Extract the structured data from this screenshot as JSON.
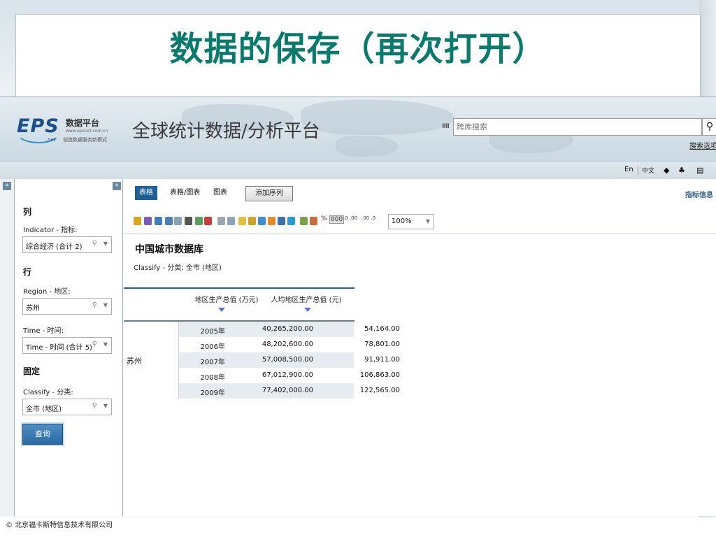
{
  "slide": {
    "title": "数据的保存（再次打开）",
    "copyright": "© 北京福卡斯特信息技术有限公司"
  },
  "header": {
    "logo_text": "EPS",
    "logo_net": "net",
    "logo_cn": "数据平台",
    "logo_url": "www.epsnet.com.cn",
    "logo_slogan": "创造数据服务新模式",
    "platform_title": "全球统计数据/分析平台",
    "search_placeholder": "跨库搜索",
    "search_options": "搜索选项"
  },
  "topbar": {
    "lang_en": "En",
    "lang_cn": "中文",
    "icons": [
      "back-icon",
      "users-icon",
      "document-icon"
    ]
  },
  "left_panel": {
    "column_section": "列",
    "indicator_label": "Indicator - 指标:",
    "indicator_value": "综合经济 (合计 2)",
    "row_section": "行",
    "region_label": "Region - 地区:",
    "region_value": "苏州",
    "time_label": "Time - 时间:",
    "time_value": "Time - 时间 (合计 5)",
    "fixed_section": "固定",
    "classify_label": "Classify - 分类:",
    "classify_value": "全市 (地区)",
    "query_button": "查询"
  },
  "main": {
    "tabs": [
      "表格",
      "表格/图表",
      "图表"
    ],
    "active_tab": "表格",
    "add_series": "添加序列",
    "indicator_info": "指标信息",
    "zoom": "100%",
    "toolbar_labels": {
      "percent": "%",
      "thousands": "000",
      "inc_dec_1": ".0 .00",
      "inc_dec_2": ".00 .0"
    },
    "db_title": "中国城市数据库",
    "db_subtitle": "Classify - 分类: 全市 (地区)"
  },
  "table": {
    "columns": [
      "地区生产总值 (万元)",
      "人均地区生产总值 (元)"
    ],
    "region": "苏州",
    "rows": [
      {
        "year": "2005年",
        "gdp": "40,265,200.00",
        "per_capita": "54,164.00"
      },
      {
        "year": "2006年",
        "gdp": "48,202,600.00",
        "per_capita": "78,801.00"
      },
      {
        "year": "2007年",
        "gdp": "57,008,500.00",
        "per_capita": "91,911.00"
      },
      {
        "year": "2008年",
        "gdp": "67,012,900.00",
        "per_capita": "106,863.00"
      },
      {
        "year": "2009年",
        "gdp": "77,402,000.00",
        "per_capita": "122,565.00"
      }
    ]
  },
  "colors": {
    "accent": "#1c6299",
    "title_green": "#0a7a6c",
    "sort_arrow": "#5a6fd6"
  }
}
